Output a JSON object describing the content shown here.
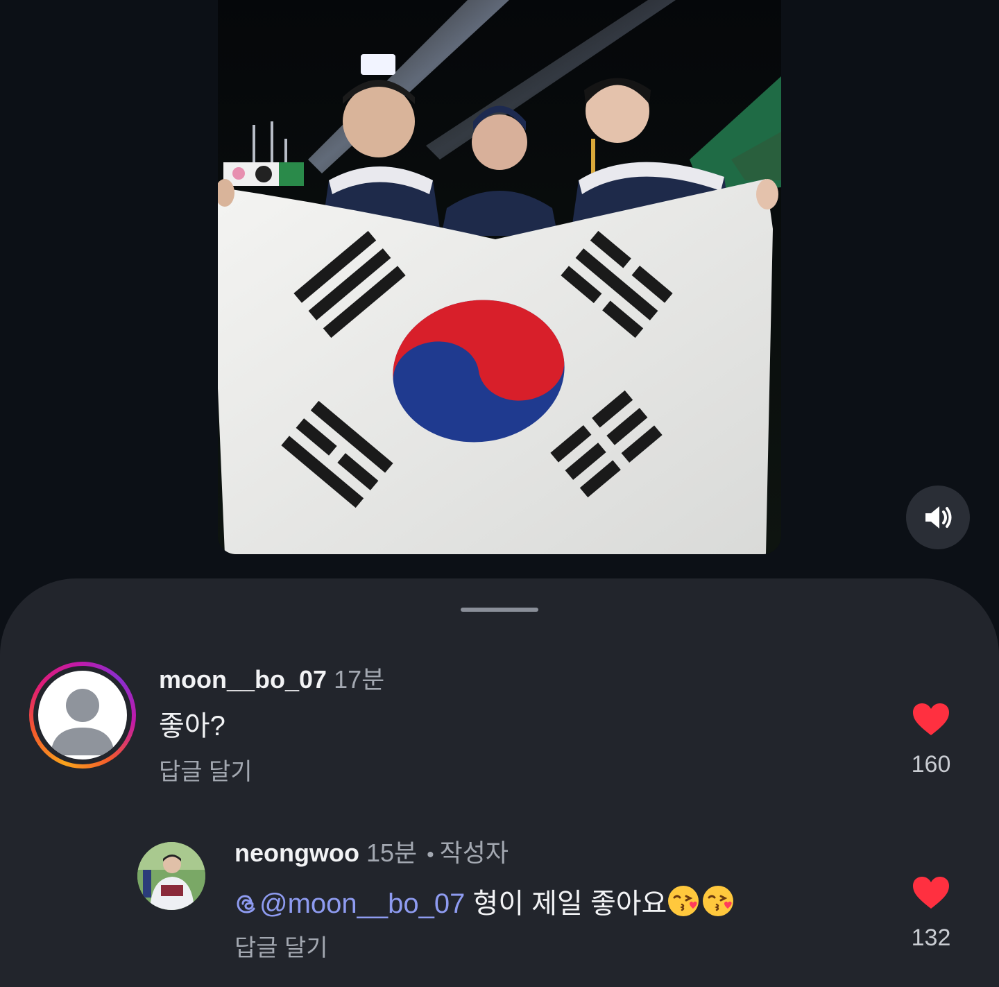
{
  "media": {
    "sound_state": "unmuted",
    "sound_icon": "speaker-icon"
  },
  "comments": [
    {
      "username": "moon__bo_07",
      "time": "17분",
      "text": "좋아?",
      "reply_label": "답글 달기",
      "like_count": "160",
      "liked": true,
      "avatar": "default-avatar-with-story-ring"
    },
    {
      "username": "neongwoo",
      "time": "15분",
      "separator": "•",
      "author_badge": "작성자",
      "mention": "@moon__bo_07",
      "text": "형이 제일 좋아요",
      "emojis": [
        "face-blowing-kiss-icon",
        "face-blowing-kiss-icon"
      ],
      "reply_label": "답글 달기",
      "like_count": "132",
      "liked": true,
      "avatar": "profile-photo"
    }
  ],
  "colors": {
    "sheet_background": "#22252c",
    "heart": "#ff3040",
    "mention": "#8e9bf0",
    "flag_red": "#d81f2a",
    "flag_blue": "#1f3a8f"
  }
}
